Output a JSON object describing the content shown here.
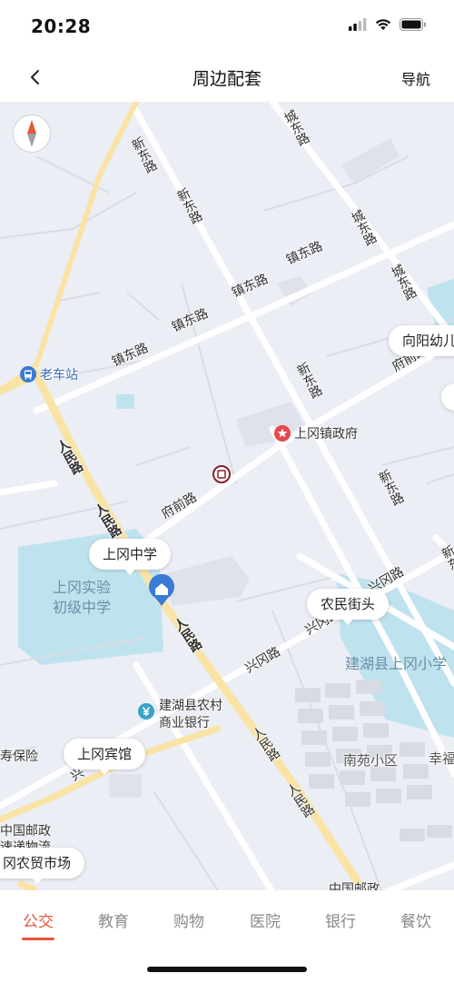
{
  "status": {
    "time": "20:28"
  },
  "nav": {
    "title": "周边配套",
    "action": "导航"
  },
  "map": {
    "roads": {
      "xin_dong_1": "新东路",
      "xin_dong_2": "新东路",
      "xin_dong_3": "新东路",
      "xin_dong_4": "新东路",
      "xin_dong_5": "新东",
      "cheng_dong_1": "城东路",
      "cheng_dong_2": "城东路",
      "cheng_dong_3": "城东路",
      "zhen_dong_1": "镇东路",
      "zhen_dong_2": "镇东路",
      "zhen_dong_3": "镇东路",
      "zhen_dong_4": "镇东路",
      "fu_qian_1": "府前路",
      "fu_qian_2": "府前路",
      "ren_min_1": "人民路",
      "ren_min_2": "人民路",
      "ren_min_3": "人民路",
      "ren_min_4": "人民路",
      "ren_min_5": "人民路",
      "xing_gang_1": "兴冈路",
      "xing_gang_2": "兴冈路",
      "xing_gang_3": "兴冈路",
      "xing_gang_4": "兴"
    },
    "pois": {
      "bus_station": "老车站",
      "town_gov": "上冈镇政府",
      "bank": "建湖县农村\n商业银行",
      "insurance": "寿保险",
      "post1": "中国邮政",
      "express": "速递物流",
      "post2": "中国邮政",
      "nanyuan": "南苑小区",
      "xing": "幸福"
    },
    "areas": {
      "school_area": "上冈实验\n初级中学",
      "primary_area": "建湖县上冈小学"
    },
    "bubbles": {
      "school": "上冈中学",
      "kindergarten": "向阳幼儿",
      "market_street": "农民街头",
      "hotel": "上冈宾馆",
      "farm_market": "冈农贸市场"
    }
  },
  "tabs": [
    {
      "label": "公交",
      "active": true
    },
    {
      "label": "教育",
      "active": false
    },
    {
      "label": "购物",
      "active": false
    },
    {
      "label": "医院",
      "active": false
    },
    {
      "label": "银行",
      "active": false
    },
    {
      "label": "餐饮",
      "active": false
    }
  ],
  "colors": {
    "accent": "#e8553a",
    "main_road": "#f9e3a5",
    "water": "#bfe3ee",
    "map_bg": "#eceef5"
  }
}
